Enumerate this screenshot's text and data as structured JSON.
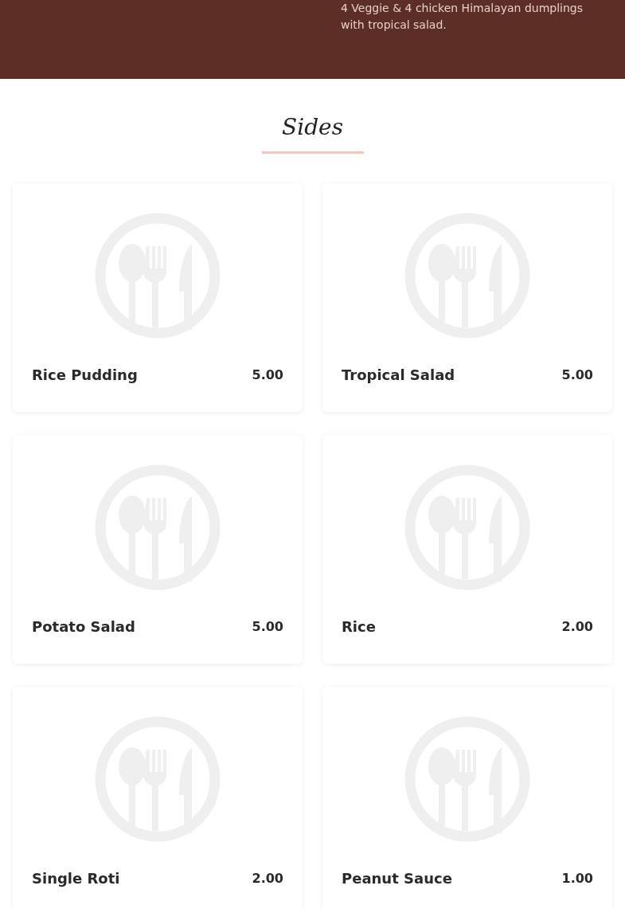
{
  "banner": {
    "description": "4 Veggie & 4 chicken Himalayan dumplings with tropical salad."
  },
  "section": {
    "title": "Sides"
  },
  "items": [
    {
      "name": "Rice Pudding",
      "price": "5.00"
    },
    {
      "name": "Tropical Salad",
      "price": "5.00"
    },
    {
      "name": "Potato Salad",
      "price": "5.00"
    },
    {
      "name": "Rice",
      "price": "2.00"
    },
    {
      "name": "Single Roti",
      "price": "2.00"
    },
    {
      "name": "Peanut Sauce",
      "price": "1.00"
    }
  ]
}
